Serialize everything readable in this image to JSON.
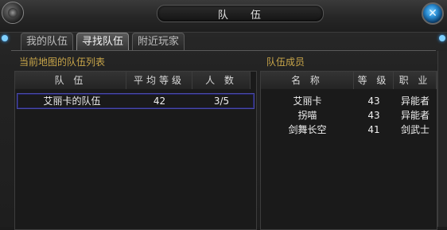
{
  "window": {
    "title": "队 伍",
    "close_label": "✕"
  },
  "tabs": [
    {
      "label": "我的队伍",
      "active": false
    },
    {
      "label": "寻找队伍",
      "active": true
    },
    {
      "label": "附近玩家",
      "active": false
    }
  ],
  "team_list": {
    "label": "当前地图的队伍列表",
    "columns": [
      "队 伍",
      "平均等级",
      "人 数"
    ],
    "rows": [
      {
        "name": "艾丽卡的队伍",
        "avg_level": "42",
        "count": "3/5"
      }
    ]
  },
  "members": {
    "label": "队伍成员",
    "columns": [
      "名 称",
      "等 级",
      "职 业"
    ],
    "rows": [
      {
        "name": "艾丽卡",
        "level": "43",
        "class": "异能者"
      },
      {
        "name": "拐喵",
        "level": "43",
        "class": "异能者"
      },
      {
        "name": "剑舞长空",
        "level": "41",
        "class": "剑武士"
      }
    ]
  },
  "colors": {
    "accent": "#c9a64a",
    "selection": "#4b4ba6",
    "close": "#2b8fd6"
  }
}
